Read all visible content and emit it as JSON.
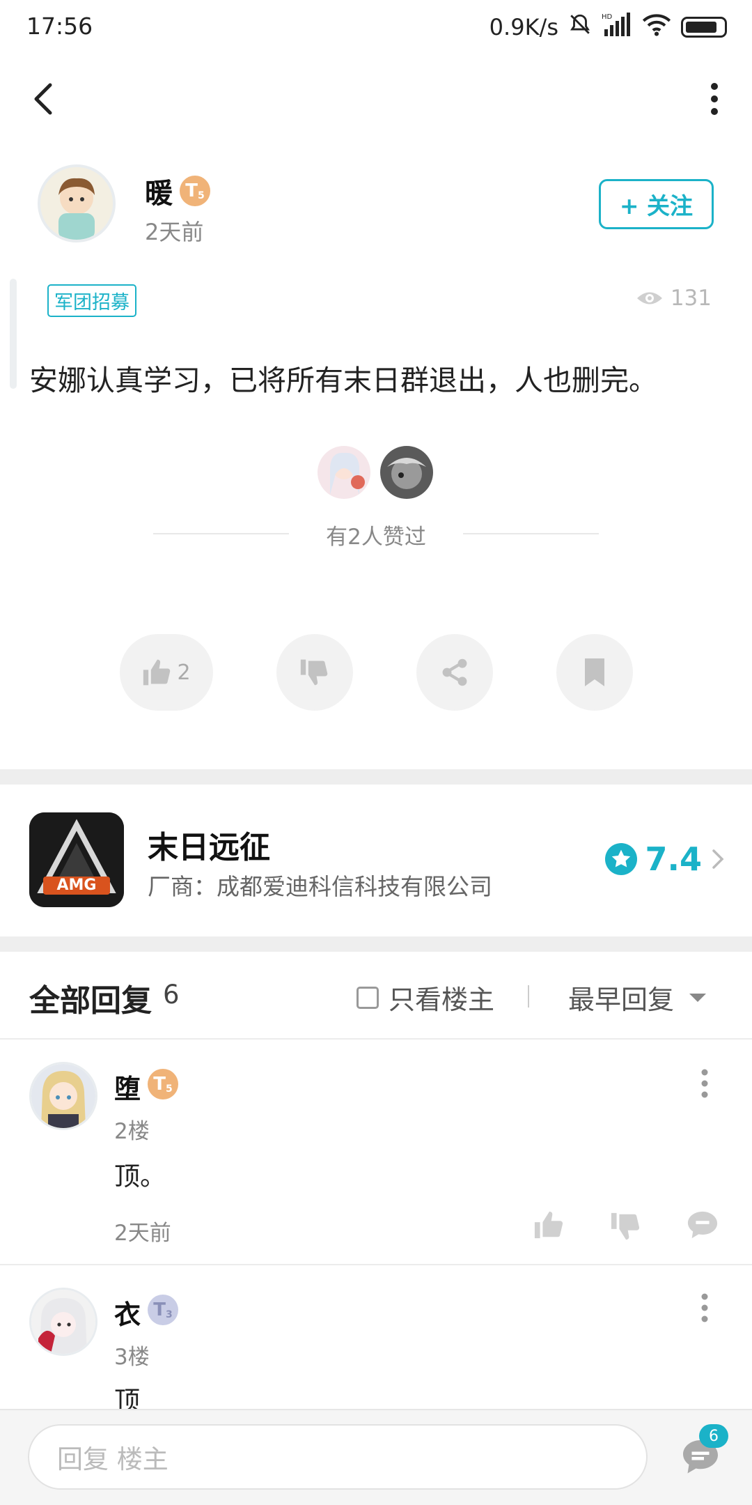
{
  "status_bar": {
    "time": "17:56",
    "net_speed": "0.9K/s",
    "hd_label": "HD"
  },
  "author": {
    "name": "暖",
    "level_badge": "T",
    "level_num": "5",
    "time": "2天前"
  },
  "follow_label": "+ 关注",
  "post": {
    "tag": "军团招募",
    "views": "131",
    "body": "安娜认真学习，已将所有末日群退出，人也删完。",
    "likers_text": "有2人赞过"
  },
  "actions": {
    "like_count": "2"
  },
  "game": {
    "name": "末日远征",
    "vendor": "厂商：成都爱迪科信科技有限公司",
    "rating": "7.4",
    "icon_text": "AMG"
  },
  "replies_header": {
    "title": "全部回复",
    "count": "6",
    "only_op": "只看楼主",
    "sort": "最早回复"
  },
  "replies": [
    {
      "name": "堕",
      "level_badge": "T",
      "level_num": "5",
      "floor": "2楼",
      "text": "顶。",
      "time": "2天前"
    },
    {
      "name": "衣",
      "level_badge": "T",
      "level_num": "3",
      "floor": "3楼",
      "text": "顶"
    }
  ],
  "bottom": {
    "reply_placeholder": "回复  楼主",
    "comment_count": "6"
  },
  "colors": {
    "accent": "#1bb2c8",
    "badge_gold": "#f0b378",
    "badge_silver": "#c9cde6"
  }
}
